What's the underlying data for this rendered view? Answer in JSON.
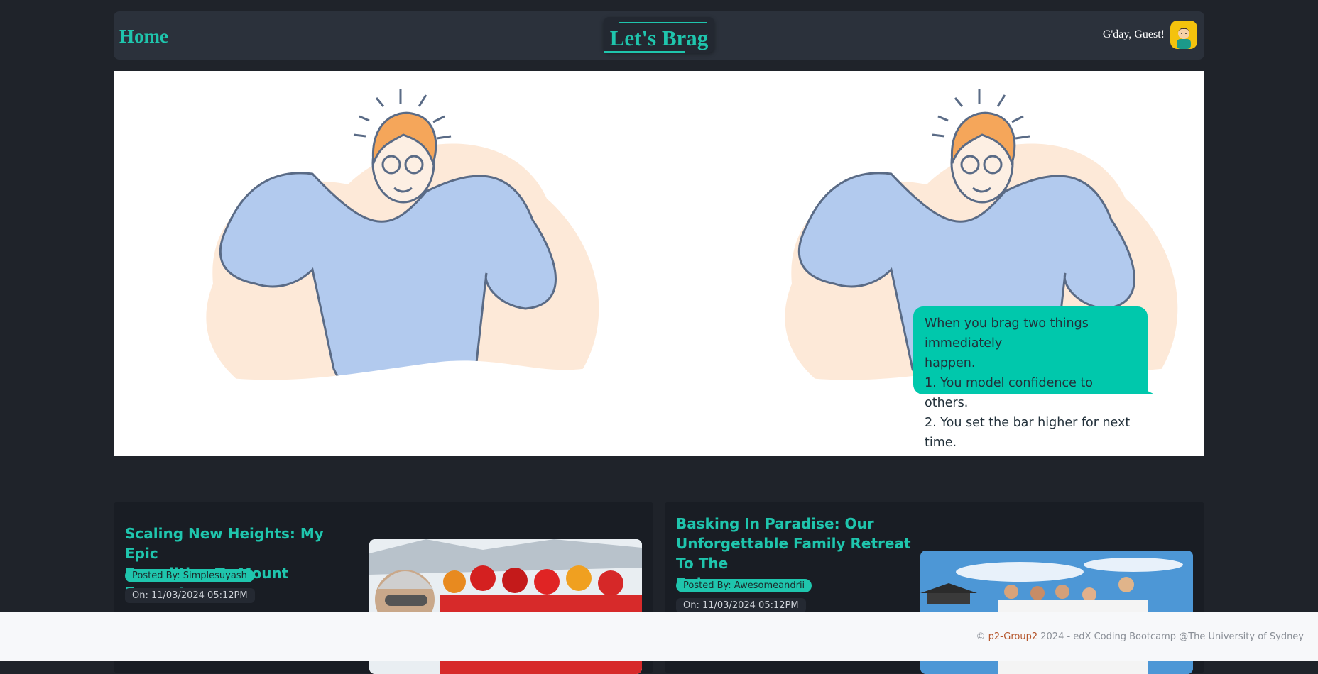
{
  "nav": {
    "home_label": "Home",
    "brand_title": "Let's Brag",
    "greeting": "G'day, Guest!",
    "avatar_icon": "user-avatar-icon"
  },
  "hero": {
    "bubble_lines": [
      "When you brag two things immediately",
      "happen.",
      "1. You model confidence to others.",
      "2. You set the bar higher for next time."
    ]
  },
  "posts": [
    {
      "title_lines": [
        "Scaling New Heights: My Epic",
        "Expedition To Mount Everest"
      ],
      "posted_by": "Posted By: Simplesuyash",
      "date": "On: 11/03/2024 05:12PM",
      "image": "everest-team-photo"
    },
    {
      "title_lines": [
        "Basking In Paradise: Our",
        "Unforgettable Family Retreat To The",
        "Bahamas"
      ],
      "posted_by": "Posted By: Awesomeandrii",
      "date": "On: 11/03/2024 05:12PM",
      "image": "bahamas-family-photo"
    }
  ],
  "footer": {
    "copyright_symbol": "©",
    "link_text": "p2-Group2",
    "rest": " 2024 - edX Coding Bootcamp @The University of Sydney"
  },
  "colors": {
    "accent": "#1fc5ad",
    "background": "#1f232a",
    "navbar": "#2b313b",
    "bubble": "#00c8ac"
  }
}
